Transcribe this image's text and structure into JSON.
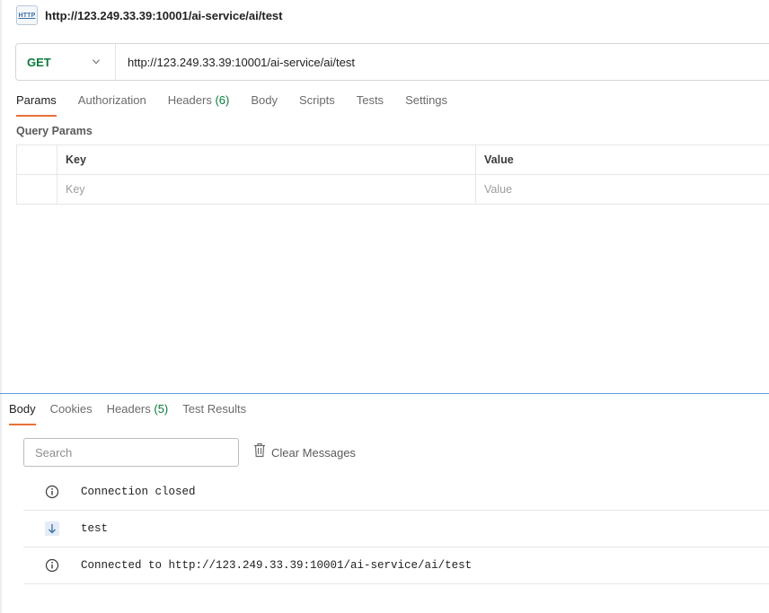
{
  "request": {
    "title": "http://123.249.33.39:10001/ai-service/ai/test",
    "icon": "http-file-icon",
    "icon_text": "HTTP",
    "method": "GET",
    "url": "http://123.249.33.39:10001/ai-service/ai/test"
  },
  "request_tabs": [
    {
      "label": "Params",
      "active": true
    },
    {
      "label": "Authorization"
    },
    {
      "label": "Headers",
      "count": "(6)"
    },
    {
      "label": "Body"
    },
    {
      "label": "Scripts"
    },
    {
      "label": "Tests"
    },
    {
      "label": "Settings"
    }
  ],
  "params": {
    "section_title": "Query Params",
    "columns": [
      "Key",
      "Value"
    ],
    "placeholders": {
      "key": "Key",
      "value": "Value"
    }
  },
  "response_tabs": [
    {
      "label": "Body",
      "active": true
    },
    {
      "label": "Cookies"
    },
    {
      "label": "Headers",
      "count": "(5)"
    },
    {
      "label": "Test Results"
    }
  ],
  "response": {
    "search_placeholder": "Search",
    "clear_label": "Clear Messages",
    "messages": [
      {
        "icon": "info-icon",
        "text": "Connection closed"
      },
      {
        "icon": "arrow-down-icon",
        "text": "test"
      },
      {
        "icon": "info-icon",
        "text": "Connected to http://123.249.33.39:10001/ai-service/ai/test"
      }
    ]
  },
  "colors": {
    "method_get": "#0a7a3c",
    "active_tab_underline": "#e8703a",
    "count": "#0a7a3c",
    "splitter": "#5e9fd8"
  }
}
